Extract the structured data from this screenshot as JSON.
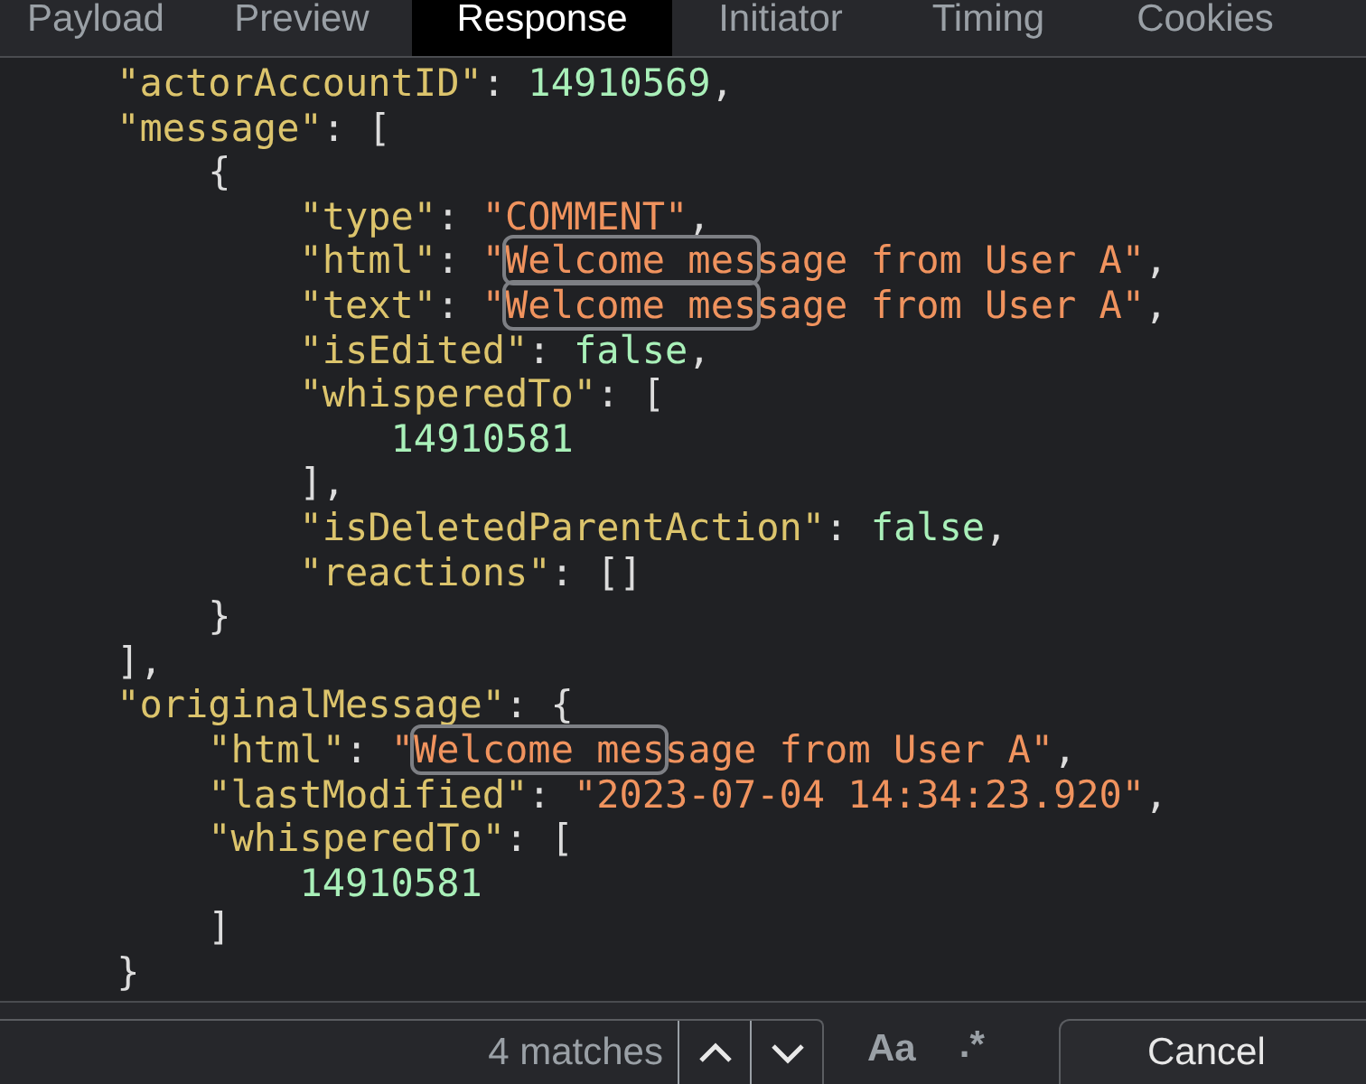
{
  "tabs": [
    {
      "label": "Payload",
      "selected": false
    },
    {
      "label": "Preview",
      "selected": false
    },
    {
      "label": "Response",
      "selected": true
    },
    {
      "label": "Initiator",
      "selected": false
    },
    {
      "label": "Timing",
      "selected": false
    },
    {
      "label": "Cookies",
      "selected": false
    }
  ],
  "response_lines": [
    {
      "tokens": [
        {
          "kind": "key",
          "text": "    \"actorAccountID\""
        },
        {
          "kind": "punct",
          "text": ": "
        },
        {
          "kind": "num",
          "text": "14910569"
        },
        {
          "kind": "punct",
          "text": ","
        }
      ]
    },
    {
      "tokens": [
        {
          "kind": "key",
          "text": "    \"message\""
        },
        {
          "kind": "punct",
          "text": ": ["
        }
      ]
    },
    {
      "tokens": [
        {
          "kind": "punct",
          "text": "        {"
        }
      ]
    },
    {
      "tokens": [
        {
          "kind": "key",
          "text": "            \"type\""
        },
        {
          "kind": "punct",
          "text": ": "
        },
        {
          "kind": "str",
          "text": "\"COMMENT\""
        },
        {
          "kind": "punct",
          "text": ","
        }
      ]
    },
    {
      "tokens": [
        {
          "kind": "key",
          "text": "            \"html\""
        },
        {
          "kind": "punct",
          "text": ": "
        },
        {
          "kind": "str",
          "text": "\""
        },
        {
          "kind": "match",
          "text": "Welcome mes"
        },
        {
          "kind": "str",
          "text": "sage from User A\""
        },
        {
          "kind": "punct",
          "text": ","
        }
      ]
    },
    {
      "tokens": [
        {
          "kind": "key",
          "text": "            \"text\""
        },
        {
          "kind": "punct",
          "text": ": "
        },
        {
          "kind": "str",
          "text": "\""
        },
        {
          "kind": "match",
          "text": "Welcome mes"
        },
        {
          "kind": "str",
          "text": "sage from User A\""
        },
        {
          "kind": "punct",
          "text": ","
        }
      ]
    },
    {
      "tokens": [
        {
          "kind": "key",
          "text": "            \"isEdited\""
        },
        {
          "kind": "punct",
          "text": ": "
        },
        {
          "kind": "lit",
          "text": "false"
        },
        {
          "kind": "punct",
          "text": ","
        }
      ]
    },
    {
      "tokens": [
        {
          "kind": "key",
          "text": "            \"whisperedTo\""
        },
        {
          "kind": "punct",
          "text": ": ["
        }
      ]
    },
    {
      "tokens": [
        {
          "kind": "num",
          "text": "                14910581"
        }
      ]
    },
    {
      "tokens": [
        {
          "kind": "punct",
          "text": "            ],"
        }
      ]
    },
    {
      "tokens": [
        {
          "kind": "key",
          "text": "            \"isDeletedParentAction\""
        },
        {
          "kind": "punct",
          "text": ": "
        },
        {
          "kind": "lit",
          "text": "false"
        },
        {
          "kind": "punct",
          "text": ","
        }
      ]
    },
    {
      "tokens": [
        {
          "kind": "key",
          "text": "            \"reactions\""
        },
        {
          "kind": "punct",
          "text": ": []"
        }
      ]
    },
    {
      "tokens": [
        {
          "kind": "punct",
          "text": "        }"
        }
      ]
    },
    {
      "tokens": [
        {
          "kind": "punct",
          "text": "    ],"
        }
      ]
    },
    {
      "tokens": [
        {
          "kind": "key",
          "text": "    \"originalMessage\""
        },
        {
          "kind": "punct",
          "text": ": {"
        }
      ]
    },
    {
      "tokens": [
        {
          "kind": "key",
          "text": "        \"html\""
        },
        {
          "kind": "punct",
          "text": ": "
        },
        {
          "kind": "str",
          "text": "\""
        },
        {
          "kind": "match",
          "text": "Welcome mes"
        },
        {
          "kind": "str",
          "text": "sage from User A\""
        },
        {
          "kind": "punct",
          "text": ","
        }
      ]
    },
    {
      "tokens": [
        {
          "kind": "key",
          "text": "        \"lastModified\""
        },
        {
          "kind": "punct",
          "text": ": "
        },
        {
          "kind": "str",
          "text": "\"2023-07-04 14:34:23.920\""
        },
        {
          "kind": "punct",
          "text": ","
        }
      ]
    },
    {
      "tokens": [
        {
          "kind": "key",
          "text": "        \"whisperedTo\""
        },
        {
          "kind": "punct",
          "text": ": ["
        }
      ]
    },
    {
      "tokens": [
        {
          "kind": "num",
          "text": "            14910581"
        }
      ]
    },
    {
      "tokens": [
        {
          "kind": "punct",
          "text": "        ]"
        }
      ]
    },
    {
      "tokens": [
        {
          "kind": "punct",
          "text": "    }"
        }
      ]
    }
  ],
  "search_bar": {
    "match_count": "4 matches",
    "case_toggle": "Aa",
    "regex_toggle": ".*",
    "cancel": "Cancel"
  }
}
